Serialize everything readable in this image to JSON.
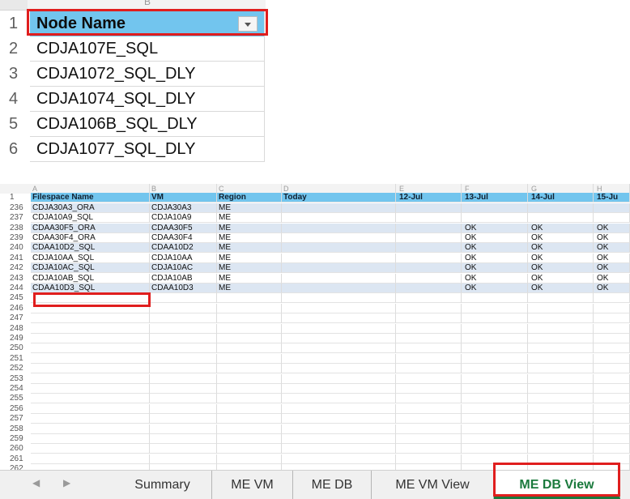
{
  "top_sheet": {
    "col_hint": "B",
    "rows": [
      {
        "num": "1",
        "value": "Node Name",
        "header": true
      },
      {
        "num": "2",
        "value": "CDJA107E_SQL"
      },
      {
        "num": "3",
        "value": "CDJA1072_SQL_DLY"
      },
      {
        "num": "4",
        "value": "CDJA1074_SQL_DLY"
      },
      {
        "num": "5",
        "value": "CDJA106B_SQL_DLY"
      },
      {
        "num": "6",
        "value": "CDJA1077_SQL_DLY"
      }
    ]
  },
  "bottom_sheet": {
    "column_letters": [
      "A",
      "B",
      "C",
      "D",
      "E",
      "F",
      "G",
      "H"
    ],
    "header_row_num": "1",
    "headers": [
      "Filespace Name",
      "VM",
      "Region",
      "Today",
      "12-Jul",
      "13-Jul",
      "14-Jul",
      "15-Ju"
    ],
    "rows": [
      {
        "num": "236",
        "cells": [
          "CDJA30A3_ORA",
          "CDJA30A3",
          "ME",
          "",
          "",
          "",
          "",
          ""
        ]
      },
      {
        "num": "237",
        "cells": [
          "CDJA10A9_SQL",
          "CDJA10A9",
          "ME",
          "",
          "",
          "",
          "",
          ""
        ]
      },
      {
        "num": "238",
        "cells": [
          "CDAA30F5_ORA",
          "CDAA30F5",
          "ME",
          "",
          "",
          "OK",
          "OK",
          "OK"
        ]
      },
      {
        "num": "239",
        "cells": [
          "CDAA30F4_ORA",
          "CDAA30F4",
          "ME",
          "",
          "",
          "OK",
          "OK",
          "OK"
        ]
      },
      {
        "num": "240",
        "cells": [
          "CDAA10D2_SQL",
          "CDAA10D2",
          "ME",
          "",
          "",
          "OK",
          "OK",
          "OK"
        ]
      },
      {
        "num": "241",
        "cells": [
          "CDJA10AA_SQL",
          "CDJA10AA",
          "ME",
          "",
          "",
          "OK",
          "OK",
          "OK"
        ]
      },
      {
        "num": "242",
        "cells": [
          "CDJA10AC_SQL",
          "CDJA10AC",
          "ME",
          "",
          "",
          "OK",
          "OK",
          "OK"
        ]
      },
      {
        "num": "243",
        "cells": [
          "CDJA10AB_SQL",
          "CDJA10AB",
          "ME",
          "",
          "",
          "OK",
          "OK",
          "OK"
        ]
      },
      {
        "num": "244",
        "cells": [
          "CDAA10D3_SQL",
          "CDAA10D3",
          "ME",
          "",
          "",
          "OK",
          "OK",
          "OK"
        ]
      }
    ],
    "empty_rows": [
      "245",
      "246",
      "247",
      "248",
      "249",
      "250",
      "251",
      "252",
      "253",
      "254",
      "255",
      "256",
      "257",
      "258",
      "259",
      "260",
      "261",
      "262"
    ]
  },
  "tabs": {
    "prev_icon": "◀",
    "next_icon": "▶",
    "items": [
      "Summary",
      "ME VM",
      "ME DB",
      "ME VM View",
      "ME DB View"
    ],
    "active": "ME DB View"
  },
  "colors": {
    "header_fill": "#72c5ee",
    "band_fill": "#dce6f2",
    "highlight": "#e01e1e",
    "active_tab": "#1b7a3d"
  }
}
